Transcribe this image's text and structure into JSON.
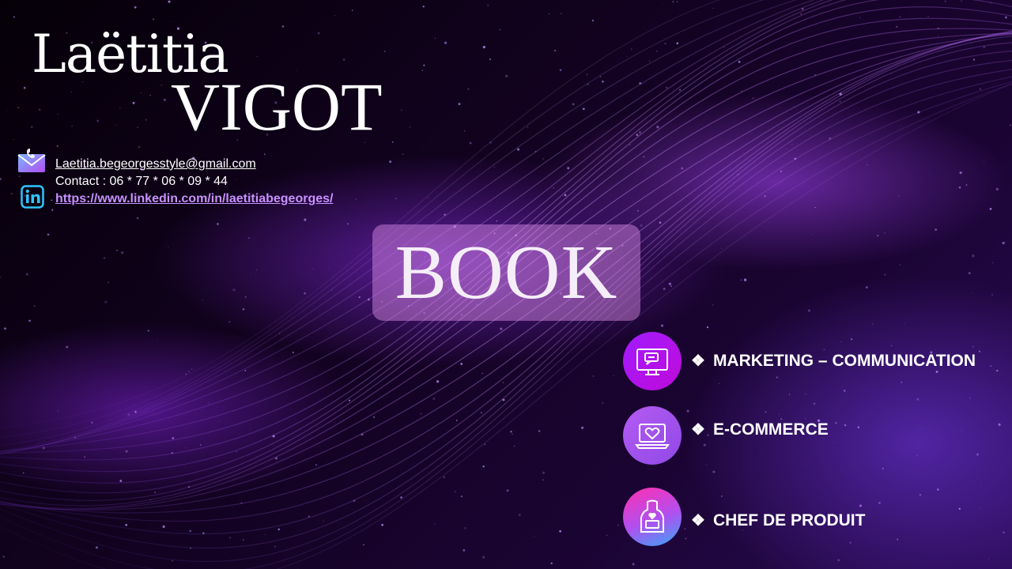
{
  "profile": {
    "first_name": "Laëtitia",
    "last_name": "VIGOT"
  },
  "contact": {
    "email": "Laetitia.begeorgesstyle@gmail.com",
    "phone": "Contact : 06 * 77 * 06 * 09 * 44",
    "linkedin": "https://www.linkedin.com/in/laetitiabegeorges/",
    "icons": [
      "envelope-phone-icon",
      "linkedin-icon"
    ]
  },
  "hero": {
    "title": "BOOK"
  },
  "domains": [
    {
      "label": "MARKETING – COMMUNICATION",
      "icon": "computer-chat-icon"
    },
    {
      "label": "E-COMMERCE",
      "icon": "laptop-heart-icon"
    },
    {
      "label": "CHEF DE PRODUIT",
      "icon": "apron-heart-icon"
    }
  ],
  "bullet": "❖",
  "colors": {
    "background": "#12021f",
    "accent_purple": "#a01cff",
    "link": "#c792ff",
    "book_box": "#e191eb"
  }
}
